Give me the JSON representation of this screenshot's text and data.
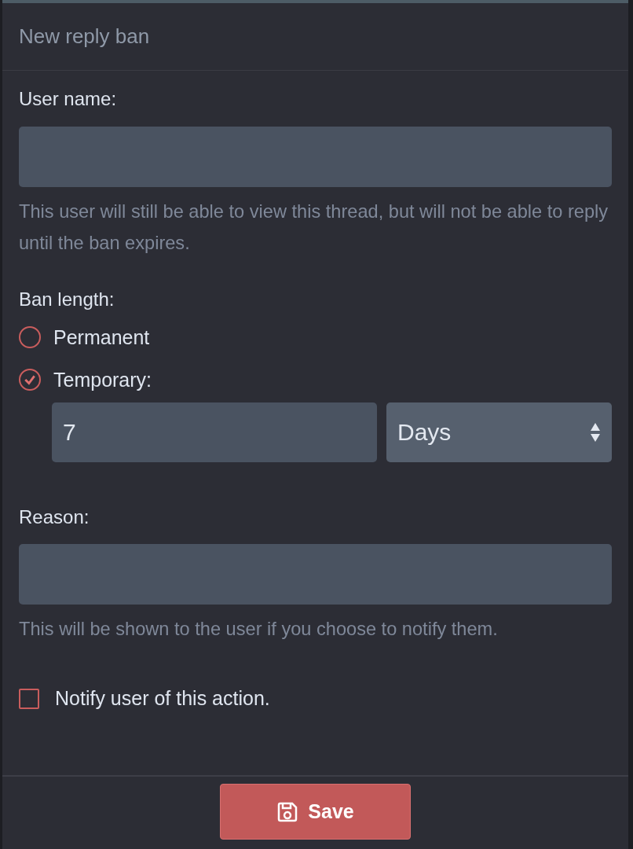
{
  "title": "New reply ban",
  "user_name": {
    "label": "User name:",
    "hint": "This user will still be able to view this thread, but will not be able to reply until the ban expires."
  },
  "ban_length": {
    "label": "Ban length:",
    "options": [
      {
        "label": "Permanent",
        "selected": false
      },
      {
        "label": "Temporary:",
        "selected": true
      }
    ],
    "amount": {
      "value": "7"
    },
    "unit": {
      "value": "Days"
    }
  },
  "reason": {
    "label": "Reason:",
    "hint": "This will be shown to the user if you choose to notify them."
  },
  "notify": {
    "label": "Notify user of this action.",
    "checked": false
  },
  "save_button": {
    "label": "Save"
  }
}
